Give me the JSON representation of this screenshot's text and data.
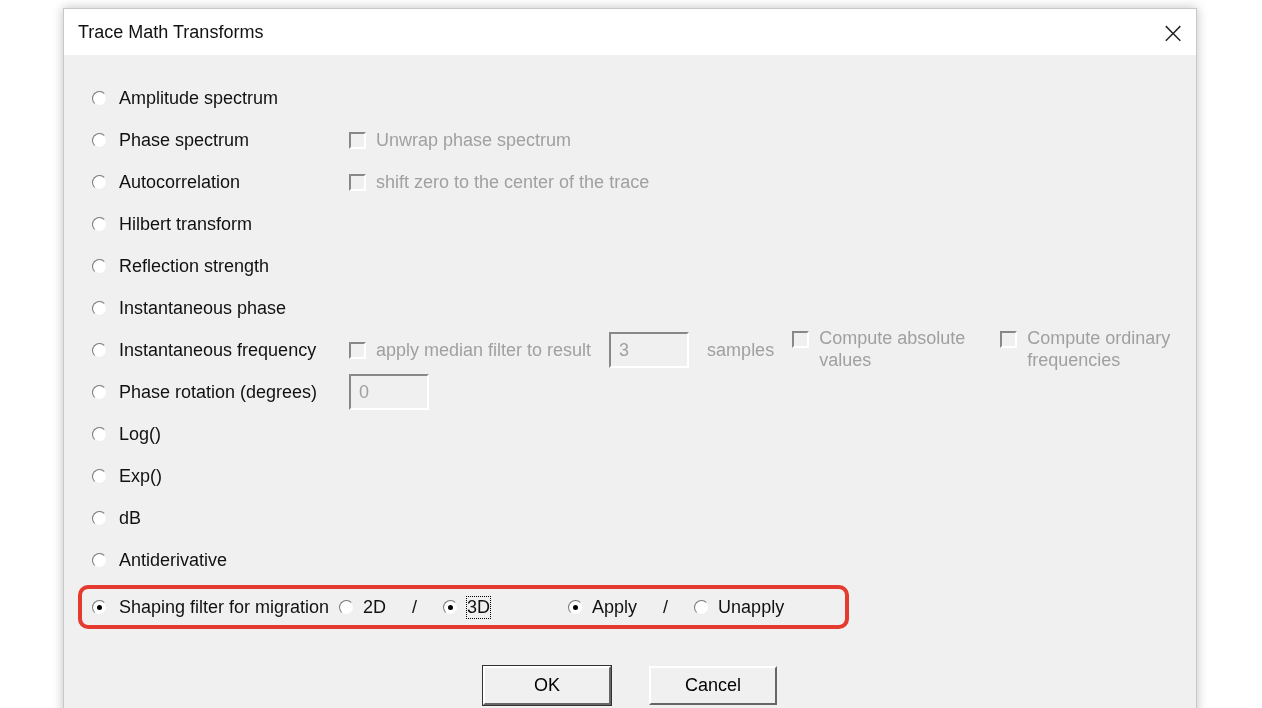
{
  "window": {
    "title": "Trace Math Transforms",
    "close": "×"
  },
  "options": [
    {
      "label": "Amplitude spectrum",
      "selected": false
    },
    {
      "label": "Phase spectrum",
      "selected": false,
      "extras": [
        {
          "kind": "checkbox",
          "label": "Unwrap phase spectrum",
          "checked": false,
          "disabled": true
        }
      ]
    },
    {
      "label": "Autocorrelation",
      "selected": false,
      "extras": [
        {
          "kind": "checkbox",
          "label": "shift zero to the center of the trace",
          "checked": false,
          "disabled": true
        }
      ]
    },
    {
      "label": "Hilbert transform",
      "selected": false
    },
    {
      "label": "Reflection strength",
      "selected": false
    },
    {
      "label": "Instantaneous phase",
      "selected": false
    },
    {
      "label": "Instantaneous frequency",
      "selected": false,
      "extras": [
        {
          "kind": "checkbox",
          "label": "apply median filter to result",
          "checked": false,
          "disabled": true
        },
        {
          "kind": "field",
          "value": "3",
          "disabled": true
        },
        {
          "kind": "text",
          "label": "samples",
          "disabled": true
        },
        {
          "kind": "checkbox",
          "label": "Compute absolute values",
          "checked": false,
          "disabled": true
        },
        {
          "kind": "checkbox",
          "label": "Compute ordinary frequencies",
          "checked": false,
          "disabled": true
        }
      ]
    },
    {
      "label": "Phase rotation (degrees)",
      "selected": false,
      "extras": [
        {
          "kind": "field",
          "value": "0",
          "disabled": true
        }
      ]
    },
    {
      "label": "Log()",
      "selected": false
    },
    {
      "label": "Exp()",
      "selected": false
    },
    {
      "label": "dB",
      "selected": false
    },
    {
      "label": "Antiderivative",
      "selected": false
    },
    {
      "label": "Shaping filter for migration",
      "selected": true,
      "highlighted": true,
      "extras": [
        {
          "kind": "group",
          "items": [
            {
              "kind": "radio",
              "label": "2D",
              "selected": false,
              "focused": false
            },
            {
              "kind": "text",
              "label": "/",
              "disabled": false
            },
            {
              "kind": "radio",
              "label": "3D",
              "selected": true,
              "focused": true
            }
          ]
        },
        {
          "kind": "group",
          "items": [
            {
              "kind": "radio",
              "label": "Apply",
              "selected": true,
              "focused": false
            },
            {
              "kind": "text",
              "label": "/",
              "disabled": false
            },
            {
              "kind": "radio",
              "label": "Unapply",
              "selected": false,
              "focused": false
            }
          ]
        }
      ]
    }
  ],
  "buttons": [
    {
      "label": "OK",
      "default": true
    },
    {
      "label": "Cancel",
      "default": false
    }
  ]
}
